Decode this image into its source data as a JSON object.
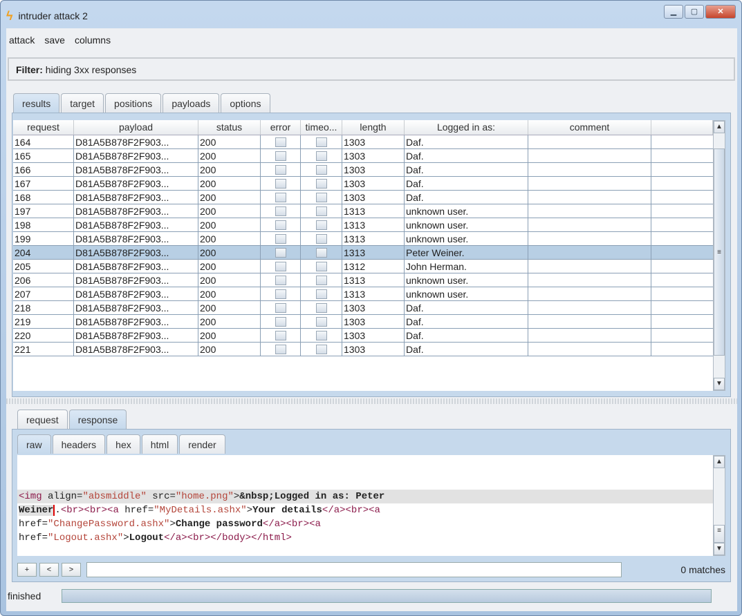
{
  "window": {
    "title": "intruder attack 2",
    "buttons": [
      "minimize",
      "maximize",
      "close"
    ]
  },
  "menu": [
    "attack",
    "save",
    "columns"
  ],
  "filter": {
    "label": "Filter:",
    "text": "hiding 3xx responses"
  },
  "tabs": [
    "results",
    "target",
    "positions",
    "payloads",
    "options"
  ],
  "active_tab": "results",
  "table": {
    "columns": [
      "request",
      "payload",
      "status",
      "error",
      "timeo...",
      "length",
      "Logged in as:",
      "comment"
    ],
    "rows": [
      [
        "164",
        "D81A5B878F2F903...",
        "200",
        "",
        "",
        "1303",
        "Daf.",
        ""
      ],
      [
        "165",
        "D81A5B878F2F903...",
        "200",
        "",
        "",
        "1303",
        "Daf.",
        ""
      ],
      [
        "166",
        "D81A5B878F2F903...",
        "200",
        "",
        "",
        "1303",
        "Daf.",
        ""
      ],
      [
        "167",
        "D81A5B878F2F903...",
        "200",
        "",
        "",
        "1303",
        "Daf.",
        ""
      ],
      [
        "168",
        "D81A5B878F2F903...",
        "200",
        "",
        "",
        "1303",
        "Daf.",
        ""
      ],
      [
        "197",
        "D81A5B878F2F903...",
        "200",
        "",
        "",
        "1313",
        "unknown user.",
        ""
      ],
      [
        "198",
        "D81A5B878F2F903...",
        "200",
        "",
        "",
        "1313",
        "unknown user.",
        ""
      ],
      [
        "199",
        "D81A5B878F2F903...",
        "200",
        "",
        "",
        "1313",
        "unknown user.",
        ""
      ],
      [
        "204",
        "D81A5B878F2F903...",
        "200",
        "",
        "",
        "1313",
        "Peter Weiner.",
        ""
      ],
      [
        "205",
        "D81A5B878F2F903...",
        "200",
        "",
        "",
        "1312",
        "John Herman.",
        ""
      ],
      [
        "206",
        "D81A5B878F2F903...",
        "200",
        "",
        "",
        "1313",
        "unknown user.",
        ""
      ],
      [
        "207",
        "D81A5B878F2F903...",
        "200",
        "",
        "",
        "1313",
        "unknown user.",
        ""
      ],
      [
        "218",
        "D81A5B878F2F903...",
        "200",
        "",
        "",
        "1303",
        "Daf.",
        ""
      ],
      [
        "219",
        "D81A5B878F2F903...",
        "200",
        "",
        "",
        "1303",
        "Daf.",
        ""
      ],
      [
        "220",
        "D81A5B878F2F903...",
        "200",
        "",
        "",
        "1303",
        "Daf.",
        ""
      ],
      [
        "221",
        "D81A5B878F2F903...",
        "200",
        "",
        "",
        "1303",
        "Daf.",
        ""
      ]
    ],
    "selected_request": "204"
  },
  "lower_tabs": [
    "request",
    "response"
  ],
  "active_lower_tab": "response",
  "sub_tabs": [
    "raw",
    "headers",
    "hex",
    "html",
    "render"
  ],
  "active_sub_tab": "raw",
  "response_lines": [
    [
      [
        "tg",
        "<img "
      ],
      [
        "",
        "align="
      ],
      [
        "st",
        "\"absmiddle\""
      ],
      [
        "",
        " src="
      ],
      [
        "st",
        "\"home.png\""
      ],
      [
        "",
        ">"
      ],
      [
        "bd",
        "&nbsp;Logged in as: Peter"
      ]
    ],
    [
      [
        "bd",
        "Weiner"
      ],
      [
        "",
        "."
      ],
      [
        "tg",
        "<br><br><a "
      ],
      [
        "",
        "href="
      ],
      [
        "st",
        "\"MyDetails.ashx\""
      ],
      [
        "",
        ">"
      ],
      [
        "bd",
        "Your details"
      ],
      [
        "tg",
        "</a><br><a"
      ]
    ],
    [
      [
        "",
        "href="
      ],
      [
        "st",
        "\"ChangePassword.ashx\""
      ],
      [
        "",
        ">"
      ],
      [
        "bd",
        "Change password"
      ],
      [
        "tg",
        "</a><br><a"
      ]
    ],
    [
      [
        "",
        "href="
      ],
      [
        "st",
        "\"Logout.ashx\""
      ],
      [
        "",
        ">"
      ],
      [
        "bd",
        "Logout"
      ],
      [
        "tg",
        "</a><br></body></html>"
      ]
    ]
  ],
  "search": {
    "buttons": [
      "+",
      "<",
      ">"
    ],
    "value": "",
    "matches": "0 matches"
  },
  "status": {
    "text": "finished"
  }
}
